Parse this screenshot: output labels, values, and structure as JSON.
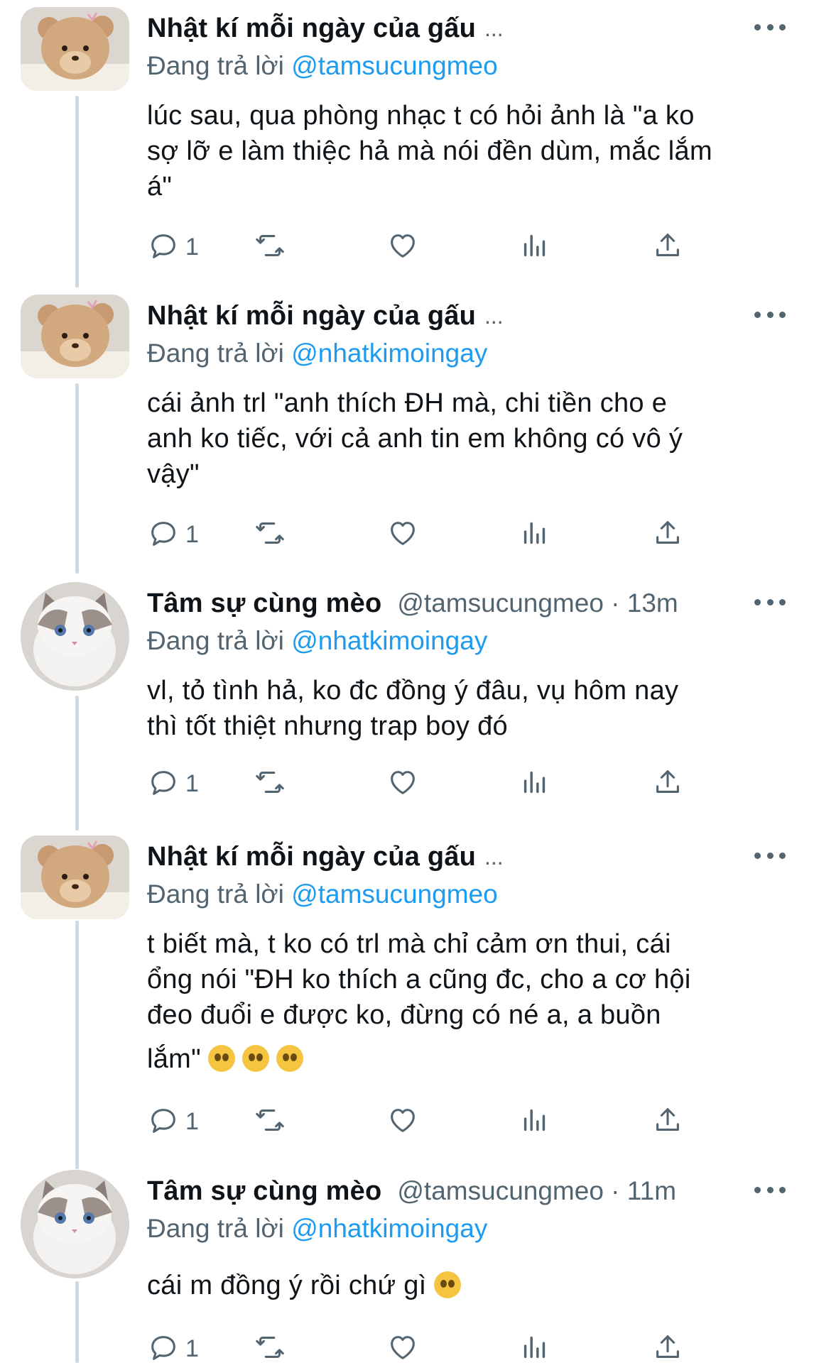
{
  "tweets": [
    {
      "display_name": "Nhật kí mỗi ngày của gấu",
      "ellipsis": "...",
      "handle_time": "",
      "reply_prefix": "Đang trả lời",
      "reply_to": "@tamsucungmeo",
      "lines": [
        "lúc sau, qua phòng nhạc t có hỏi ảnh là \"a ko",
        "sợ lỡ e làm thiệc hả mà nói đền dùm, mắc lắm",
        "á\""
      ],
      "reply_count": "1",
      "avatar": "bear-avatar"
    },
    {
      "display_name": "Nhật kí mỗi ngày của gấu",
      "ellipsis": "...",
      "handle_time": "",
      "reply_prefix": "Đang trả lời",
      "reply_to": "@nhatkimoingay",
      "lines": [
        "cái ảnh trl \"anh thích ĐH mà, chi tiền cho e",
        "anh ko tiếc, với cả anh tin em không có vô ý",
        "vậy\""
      ],
      "reply_count": "1",
      "avatar": "bear-avatar"
    },
    {
      "display_name": "Tâm sự cùng mèo",
      "ellipsis": "",
      "handle_time": "@tamsucungmeo · 13m",
      "reply_prefix": "Đang trả lời",
      "reply_to": "@nhatkimoingay",
      "lines": [
        "vl, tỏ tình hả, ko đc đồng ý đâu, vụ hôm nay",
        "thì tốt thiệt nhưng trap boy đó"
      ],
      "reply_count": "1",
      "avatar": "cat-avatar"
    },
    {
      "display_name": "Nhật kí mỗi ngày của gấu",
      "ellipsis": "...",
      "handle_time": "",
      "reply_prefix": "Đang trả lời",
      "reply_to": "@tamsucungmeo",
      "lines": [
        "t biết mà, t ko có trl mà chỉ cảm ơn thui, cái",
        "ổng nói \"ĐH ko thích a cũng đc, cho a cơ hội",
        "đeo đuổi e được ko, đừng có né a, a buồn",
        "lắm\""
      ],
      "last_line_emojis": [
        "pleading-face-emoji",
        "pleading-face-emoji",
        "pleading-face-emoji"
      ],
      "reply_count": "1",
      "avatar": "bear-avatar"
    },
    {
      "display_name": "Tâm sự cùng mèo",
      "ellipsis": "",
      "handle_time": "@tamsucungmeo · 11m",
      "reply_prefix": "Đang trả lời",
      "reply_to": "@nhatkimoingay",
      "lines": [
        "cái m đồng ý rồi chứ gì"
      ],
      "last_line_emojis": [
        "smiling-face-emoji"
      ],
      "reply_count": "1",
      "avatar": "cat-avatar"
    }
  ],
  "colors": {
    "text": "#0f1419",
    "secondary": "#536471",
    "link": "#1d9bf0",
    "thread_line": "#cfd9de"
  }
}
